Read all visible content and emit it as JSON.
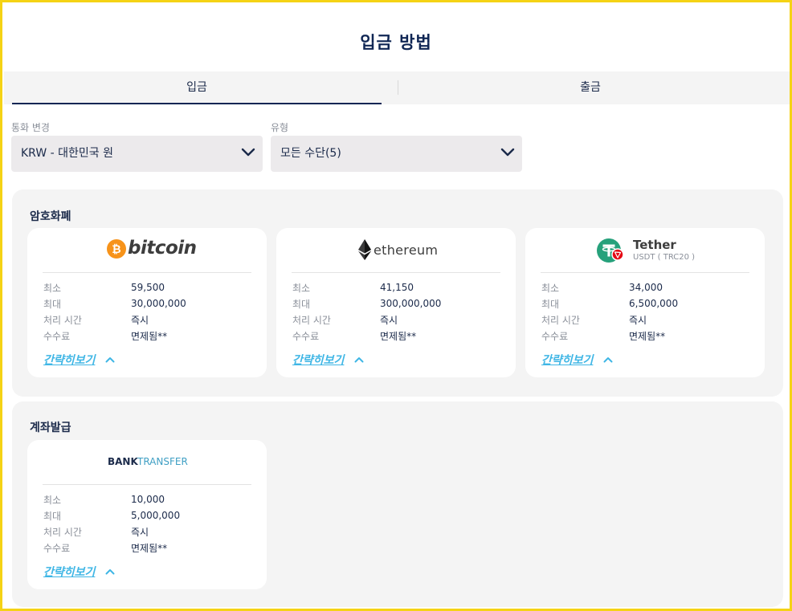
{
  "page": {
    "title": "입금 방법"
  },
  "tabs": [
    {
      "label": "입금",
      "active": true
    },
    {
      "label": "출금",
      "active": false
    }
  ],
  "filters": {
    "currency": {
      "label": "통화 변경",
      "value": "KRW - 대한민국 원"
    },
    "type": {
      "label": "유형",
      "value": "모든 수단(5)"
    }
  },
  "row_labels": {
    "min": "최소",
    "max": "최대",
    "time": "처리 시간",
    "fee": "수수료"
  },
  "toggle_label": "간략히보기",
  "sections": [
    {
      "title": "암호화폐",
      "cards": [
        {
          "logo_text": "bitcoin",
          "logo_icon": "bitcoin-icon",
          "min": "59,500",
          "max": "30,000,000",
          "time": "즉시",
          "fee": "면제됨**"
        },
        {
          "logo_text": "ethereum",
          "logo_icon": "ethereum-icon",
          "min": "41,150",
          "max": "300,000,000",
          "time": "즉시",
          "fee": "면제됨**"
        },
        {
          "logo_text": "Tether",
          "logo_subtext": "USDT ( TRC20 )",
          "logo_icon": "tether-icon",
          "min": "34,000",
          "max": "6,500,000",
          "time": "즉시",
          "fee": "면제됨**"
        }
      ]
    },
    {
      "title": "계좌발급",
      "cards": [
        {
          "logo_text": "BANK",
          "logo_text_2": "TRANSFER",
          "logo_icon": "bank-transfer-logo",
          "min": "10,000",
          "max": "5,000,000",
          "time": "즉시",
          "fee": "면제됨**"
        }
      ]
    }
  ],
  "colors": {
    "navy": "#0f2654",
    "accent_link": "#3fb6e5",
    "bitcoin": "#f7931a",
    "tether": "#26a17b",
    "tron": "#e50914",
    "frame": "#f5d315"
  }
}
